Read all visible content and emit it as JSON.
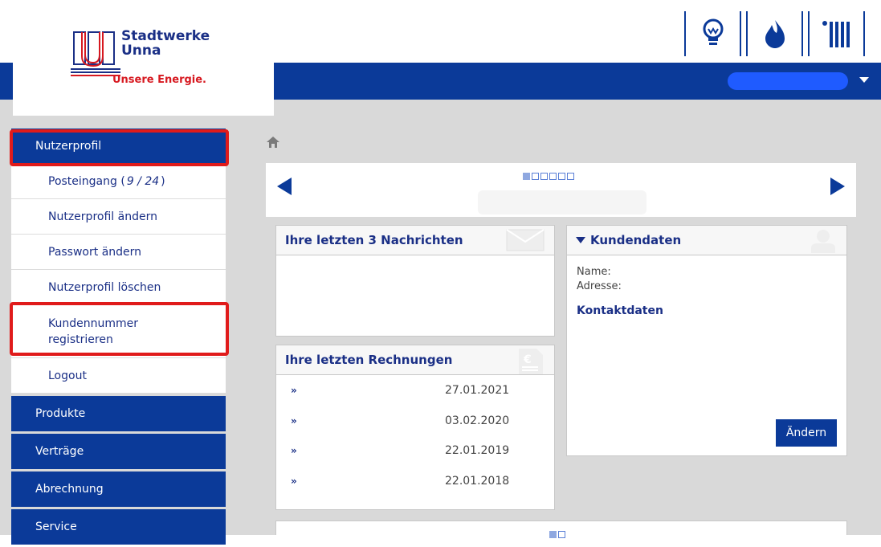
{
  "logo": {
    "name_line1": "Stadtwerke",
    "name_line2": "Unna",
    "slogan": "Unsere Energie."
  },
  "utility_icons": [
    "bulb-icon",
    "flame-icon",
    "radiator-icon"
  ],
  "user_menu": {
    "caret_icon": "caret-down-icon"
  },
  "sidebar": {
    "main_nutzerprofil": "Nutzerprofil",
    "sub_items": {
      "posteingang_label": "Posteingang (",
      "posteingang_count": "9 / 24",
      "posteingang_close": ")",
      "profil_aendern": "Nutzerprofil ändern",
      "passwort_aendern": "Passwort ändern",
      "profil_loeschen": "Nutzerprofil löschen",
      "kundennummer_line1": "Kundennummer",
      "kundennummer_line2": "registrieren",
      "logout": "Logout"
    },
    "main_items": [
      "Produkte",
      "Verträge",
      "Abrechnung",
      "Service"
    ]
  },
  "slider": {
    "dots_total": 6,
    "active_dot": 1
  },
  "nachrichten_panel": {
    "title": "Ihre letzten 3 Nachrichten"
  },
  "rechnungen_panel": {
    "title": "Ihre letzten Rechnungen",
    "arrow": "»",
    "dates": [
      "27.01.2021",
      "03.02.2020",
      "22.01.2019",
      "22.01.2018"
    ]
  },
  "kundendaten_panel": {
    "title": "Kundendaten",
    "name_label": "Name:",
    "adresse_label": "Adresse:",
    "kontakt_link": "Kontaktdaten",
    "button": "Ändern"
  },
  "colors": {
    "brand_blue": "#0b3a99",
    "highlight_red": "#e01b1b",
    "background_gray": "#d9d9d9"
  }
}
